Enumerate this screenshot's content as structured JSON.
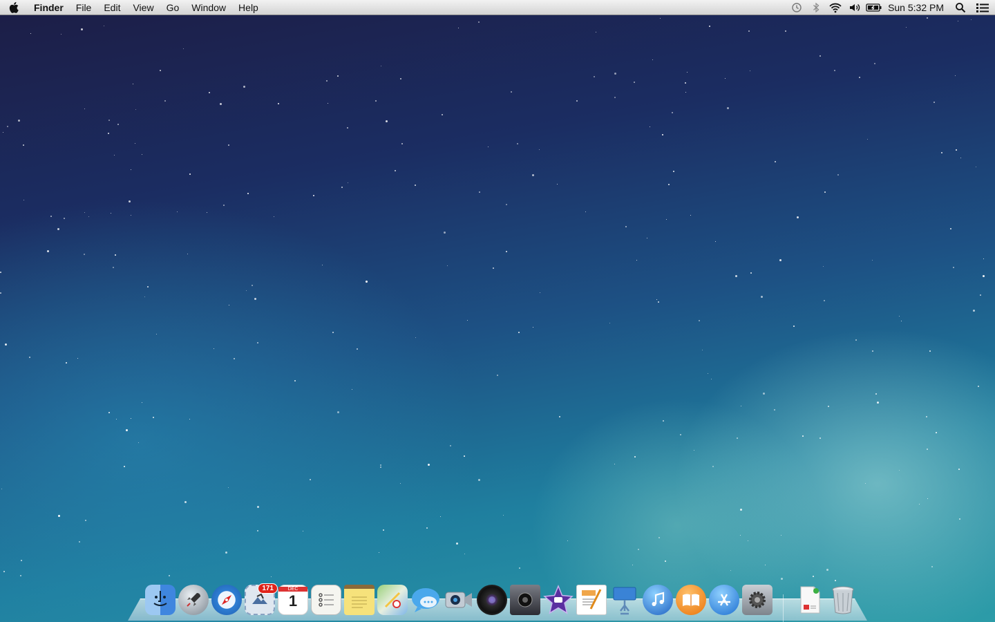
{
  "menubar": {
    "apple_icon": "apple-icon",
    "app_name": "Finder",
    "items": [
      "File",
      "Edit",
      "View",
      "Go",
      "Window",
      "Help"
    ],
    "clock": "Sun 5:32 PM",
    "status_icons": [
      "time-machine-icon",
      "bluetooth-icon",
      "wifi-icon",
      "volume-icon",
      "battery-icon",
      "spotlight-icon",
      "notification-center-icon"
    ]
  },
  "dock": {
    "apps": [
      {
        "name": "Finder",
        "icon": "finder-icon",
        "color": "#5b9ee8"
      },
      {
        "name": "Launchpad",
        "icon": "launchpad-rocket-icon",
        "color": "#9aa3ad"
      },
      {
        "name": "Safari",
        "icon": "safari-compass-icon",
        "color": "#3a8ee0"
      },
      {
        "name": "Mail",
        "icon": "mail-stamp-icon",
        "color": "#6a8fbf",
        "badge": "171"
      },
      {
        "name": "Calendar",
        "icon": "calendar-icon",
        "color": "#ffffff",
        "month": "DEC",
        "day": "1"
      },
      {
        "name": "Reminders",
        "icon": "reminders-icon",
        "color": "#f3f3ef"
      },
      {
        "name": "Notes",
        "icon": "notes-icon",
        "color": "#f5e27a"
      },
      {
        "name": "Maps",
        "icon": "maps-icon",
        "color": "#8cc86a"
      },
      {
        "name": "Messages",
        "icon": "messages-bubble-icon",
        "color": "#4aa8ec"
      },
      {
        "name": "FaceTime",
        "icon": "facetime-camera-icon",
        "color": "#b8c2cc"
      },
      {
        "name": "Photo Booth",
        "icon": "photo-booth-icon",
        "color": "#2a2a2a"
      },
      {
        "name": "Logic",
        "icon": "logic-icon",
        "color": "#4a4a55"
      },
      {
        "name": "iMovie",
        "icon": "imovie-star-icon",
        "color": "#6a3ba8"
      },
      {
        "name": "Pages",
        "icon": "pages-icon",
        "color": "#f0a64a"
      },
      {
        "name": "Keynote",
        "icon": "keynote-icon",
        "color": "#4a90d9"
      },
      {
        "name": "iTunes",
        "icon": "itunes-note-icon",
        "color": "#2c7fd6"
      },
      {
        "name": "iBooks",
        "icon": "ibooks-icon",
        "color": "#f08a1c"
      },
      {
        "name": "App Store",
        "icon": "app-store-icon",
        "color": "#2f8fe6"
      },
      {
        "name": "System Preferences",
        "icon": "system-preferences-gear-icon",
        "color": "#8a8f96"
      }
    ],
    "others": [
      {
        "name": "Document",
        "icon": "document-icon",
        "color": "#f7f7f7"
      },
      {
        "name": "Trash",
        "icon": "trash-icon",
        "color": "#c5ccd3"
      }
    ]
  }
}
